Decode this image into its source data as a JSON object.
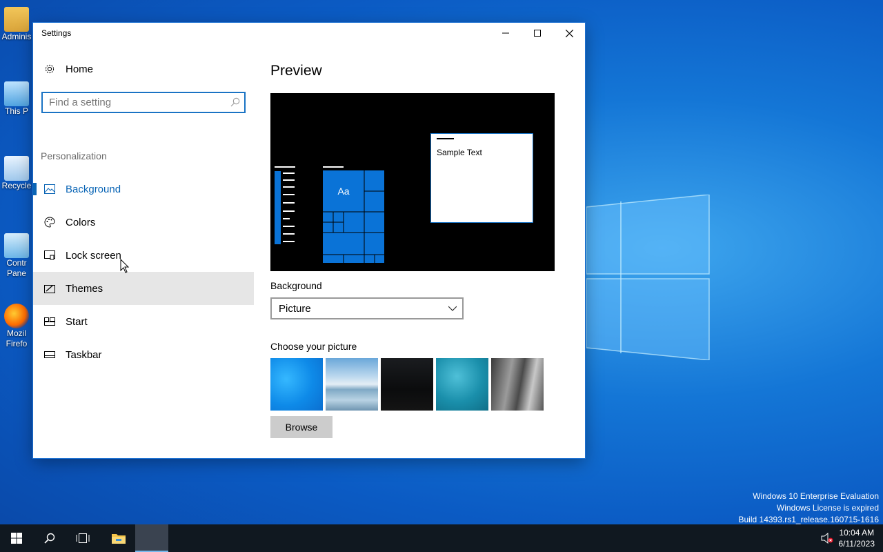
{
  "desktop": {
    "icons": [
      {
        "label": "Adminis"
      },
      {
        "label": "This P"
      },
      {
        "label": "Recycle"
      },
      {
        "label": "Contr Pane"
      },
      {
        "label": "Mozil Firefo"
      }
    ],
    "watermark": {
      "line1": "Windows 10 Enterprise Evaluation",
      "line2": "Windows License is expired",
      "line3": "Build 14393.rs1_release.160715-1616"
    }
  },
  "window": {
    "title": "Settings"
  },
  "nav": {
    "home": "Home",
    "search_placeholder": "Find a setting",
    "section": "Personalization",
    "items": [
      {
        "label": "Background",
        "icon": "picture-icon",
        "selected": true
      },
      {
        "label": "Colors",
        "icon": "palette-icon"
      },
      {
        "label": "Lock screen",
        "icon": "lock-screen-icon"
      },
      {
        "label": "Themes",
        "icon": "themes-icon"
      },
      {
        "label": "Start",
        "icon": "start-layout-icon"
      },
      {
        "label": "Taskbar",
        "icon": "taskbar-icon"
      }
    ]
  },
  "content": {
    "preview_heading": "Preview",
    "sample_text": "Sample Text",
    "tile_text": "Aa",
    "background_label": "Background",
    "background_value": "Picture",
    "choose_label": "Choose your picture",
    "browse_label": "Browse",
    "accent_color": "#0a73d7"
  },
  "taskbar": {
    "time": "10:04 AM",
    "date": "6/11/2023"
  }
}
